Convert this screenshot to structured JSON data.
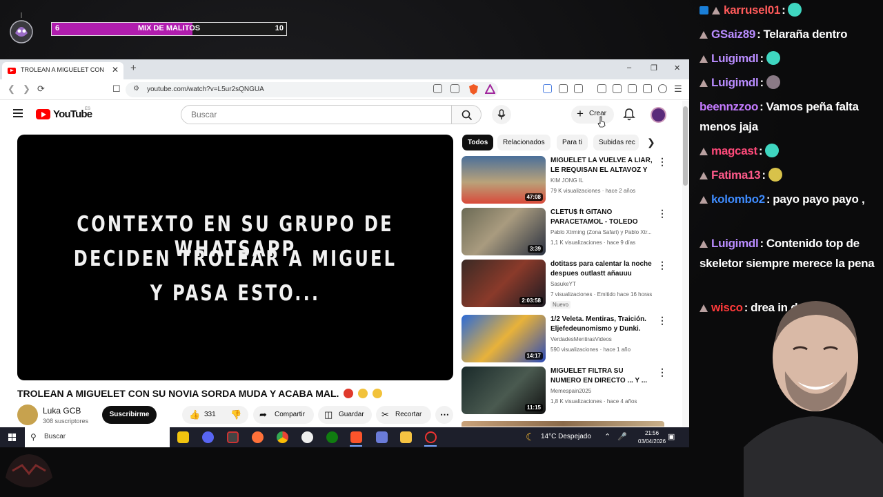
{
  "overlay": {
    "mix_left": "6",
    "mix_title": "MIX DE MALITOS",
    "mix_right": "10",
    "mix_progress": 0.6
  },
  "browser": {
    "tab_title": "TROLEAN A MIGUELET CON SU",
    "url": "youtube.com/watch?v=L5ur2sQNGUA",
    "minimize": "–",
    "restore": "❐",
    "close": "✕",
    "new_tab": "+",
    "tab_close": "✕"
  },
  "youtube": {
    "wordmark": "YouTube",
    "region": "ES",
    "search_placeholder": "Buscar",
    "create_label": "Crear",
    "player_lines": [
      "CONTEXTO EN SU GRUPO DE WHATSAPP",
      "DECIDEN TROLEAR A MIGUEL",
      "Y PASA ESTO..."
    ],
    "video_title": "TROLEAN A MIGUELET CON SU NOVIA SORDA MUDA Y ACABA MAL.",
    "channel_name": "Luka GCB",
    "channel_subs": "308 suscriptores",
    "subscribe_label": "Suscribirme",
    "likes": "331",
    "share_label": "Compartir",
    "save_label": "Guardar",
    "clip_label": "Recortar",
    "chips": [
      "Todos",
      "Relacionados",
      "Para ti",
      "Subidas rec"
    ],
    "recommendations": [
      {
        "title": "MIGUELET LA VUELVE A LIAR, LE REQUISAN EL ALTAVOZ Y ...",
        "channel": "KIM JONG IL",
        "meta": "79 K visualizaciones · hace 2 años",
        "duration": "47:08",
        "badge": ""
      },
      {
        "title": "CLETU$ ft GITANO PARACETAMOL - TOLEDO BOYZ",
        "channel": "Pablo Xtrming (Zona Safari) y Pablo Xtr...",
        "meta": "1,1 K visualizaciones · hace 9 días",
        "duration": "3:39",
        "badge": ""
      },
      {
        "title": "dotitass para calentar la noche despues outlastt añauuu",
        "channel": "SasukeYT",
        "meta": "7 visualizaciones · Emitido hace 16 horas",
        "duration": "2:03:58",
        "badge": "Nuevo"
      },
      {
        "title": "1/2 Veleta. Mentiras, Traición. Eljefedeunomismo y Dunki.",
        "channel": "VerdadesMentirasVideos",
        "meta": "590 visualizaciones · hace 1 año",
        "duration": "14:17",
        "badge": ""
      },
      {
        "title": "MIGUELET FILTRA SU NUMERO EN DIRECTO ... Y ...",
        "channel": "Memespain2025",
        "meta": "1,8 K visualizaciones · hace 4 años",
        "duration": "11:15",
        "badge": ""
      }
    ]
  },
  "taskbar": {
    "search_label": "Buscar",
    "weather": "14°C  Despejado",
    "time": "21:56",
    "date": "03/04/2026"
  },
  "chat": [
    {
      "user": "karrusel01",
      "color": "#ff5a5a",
      "text": "",
      "emote": "#3fd6c0",
      "badges": [
        "mod",
        "vip"
      ]
    },
    {
      "user": "GSaiz89",
      "color": "#b98cff",
      "text": "Telaraña dentro",
      "emote": "",
      "badges": [
        "vip"
      ]
    },
    {
      "user": "Luigimdl",
      "color": "#b98cff",
      "text": "",
      "emote": "#3fd6c0",
      "badges": [
        "vip"
      ]
    },
    {
      "user": "Luigimdl",
      "color": "#b98cff",
      "text": "",
      "emote": "#8a7a86",
      "badges": [
        "vip"
      ]
    },
    {
      "user": "beennzzoo",
      "color": "#c47bff",
      "text": "Vamos peña falta menos jaja",
      "emote": "",
      "badges": []
    },
    {
      "user": "magcast",
      "color": "#ff4a7a",
      "text": "",
      "emote": "#3fd6c0",
      "badges": [
        "vip"
      ]
    },
    {
      "user": "Fatima13",
      "color": "#ff5a8a",
      "text": "",
      "emote": "#d8c24a",
      "badges": [
        "vip"
      ]
    },
    {
      "user": "kolombo2",
      "color": "#3f8cff",
      "text": "payo payo payo ,",
      "emote": "",
      "badges": [
        "vip"
      ]
    },
    {
      "user": "Luigimdl",
      "color": "#b98cff",
      "text": "Contenido top de skeletor siempre merece la pena",
      "emote": "",
      "badges": [
        "vip"
      ]
    },
    {
      "user": "wisco",
      "color": "#ff3a3a",
      "text": "drea in da pilón",
      "emote": "",
      "badges": [
        "vip"
      ]
    }
  ]
}
